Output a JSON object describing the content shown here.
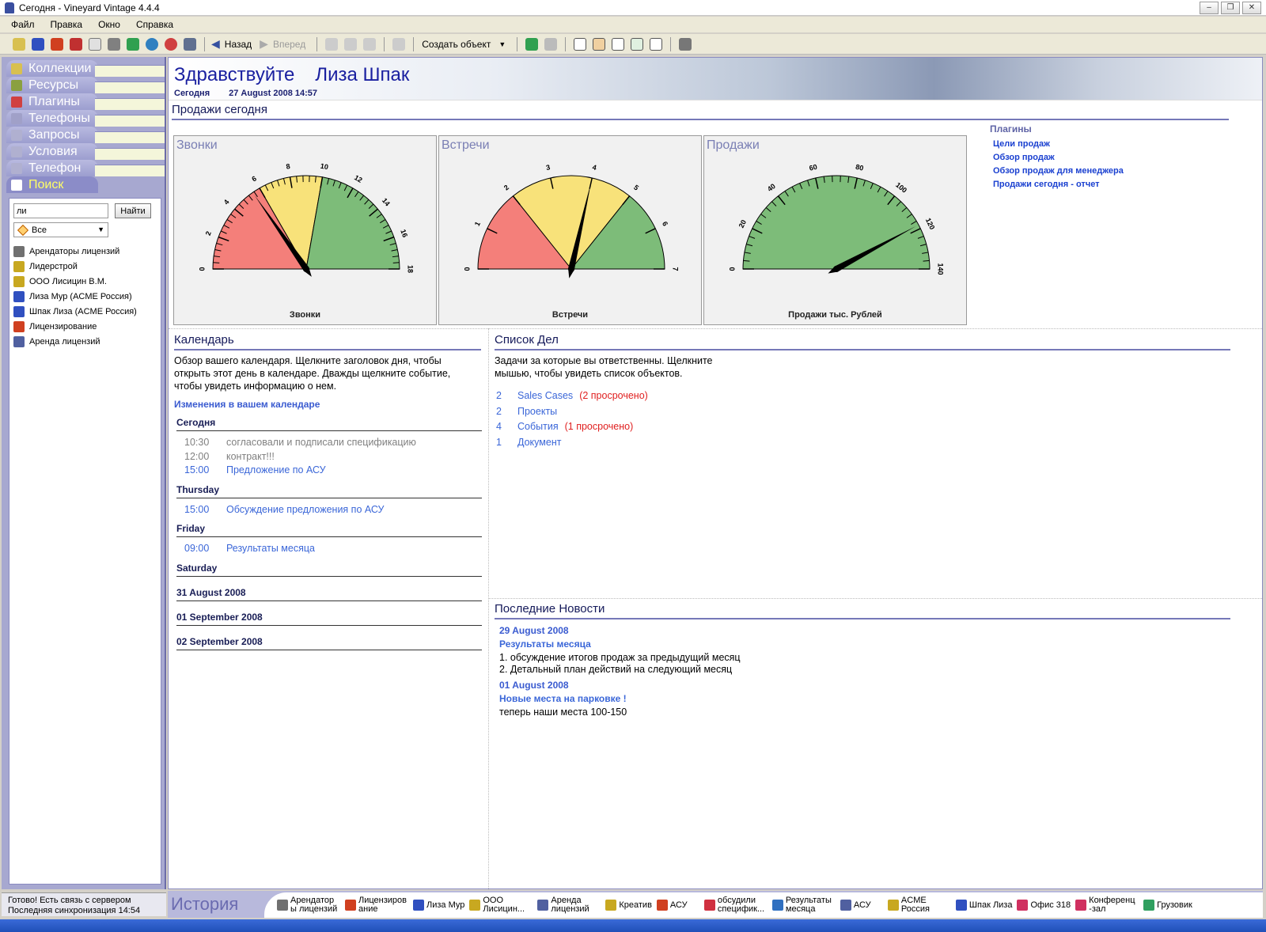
{
  "window": {
    "title": "Сегодня - Vineyard Vintage 4.4.4"
  },
  "menu": [
    "Файл",
    "Правка",
    "Окно",
    "Справка"
  ],
  "toolbar": {
    "back": "Назад",
    "forward": "Вперед",
    "create": "Создать объект"
  },
  "nav": {
    "tabs": [
      {
        "label": "Коллекции",
        "icon": "collections-icon",
        "color": "#d8c050"
      },
      {
        "label": "Ресурсы",
        "icon": "resources-icon",
        "color": "#8aa040"
      },
      {
        "label": "Плагины",
        "icon": "plugins-icon",
        "color": "#d04040"
      },
      {
        "label": "Телефоны",
        "icon": "phonebook-icon",
        "color": "#a0a0c8"
      },
      {
        "label": "Запросы",
        "icon": "queries-icon",
        "color": "#b0b0d0"
      },
      {
        "label": "Условия",
        "icon": "conditions-icon",
        "color": "#b0b0d0"
      },
      {
        "label": "Телефон",
        "icon": "phone-icon",
        "color": "#b0b0d0"
      },
      {
        "label": "Поиск",
        "icon": "search-icon",
        "color": "#ffffff"
      }
    ],
    "search_value": "ли",
    "search_button": "Найти",
    "filter_value": "Все",
    "results": [
      {
        "label": "Арендаторы лицензий",
        "icon": "group-icon",
        "color": "#707070"
      },
      {
        "label": "Лидерстрой",
        "icon": "company-icon",
        "color": "#c8a820"
      },
      {
        "label": "ООО Лисицин В.М.",
        "icon": "company-icon",
        "color": "#c8a820"
      },
      {
        "label": "Лиза Мур (ACME Россия)",
        "icon": "person-icon",
        "color": "#3050c0"
      },
      {
        "label": "Шпак Лиза (ACME Россия)",
        "icon": "person-icon",
        "color": "#3050c0"
      },
      {
        "label": "Лицензирование",
        "icon": "project-icon",
        "color": "#d04020"
      },
      {
        "label": "Аренда лицензий",
        "icon": "document-icon",
        "color": "#5060a0"
      }
    ],
    "status_line1": "Готово! Есть связь с сервером",
    "status_line2": "Последняя синхронизация 14:54"
  },
  "banner": {
    "greeting": "Здравствуйте",
    "name": "Лиза Шпак",
    "today": "Сегодня",
    "datetime": "27 August 2008 14:57"
  },
  "sales": {
    "title": "Продажи сегодня",
    "plugins_header": "Плагины",
    "plugins": [
      "Цели продаж",
      "Обзор продаж",
      "Обзор продаж для менеджера",
      "Продажи сегодня - отчет"
    ],
    "gauges": [
      {
        "title": "Звонки",
        "caption": "Звонки",
        "min": 0,
        "max": 18,
        "ticks": [
          0,
          2,
          4,
          6,
          8,
          10,
          12,
          14,
          16,
          18
        ],
        "minor": 4,
        "zones": [
          [
            0,
            6,
            "#f47f7a"
          ],
          [
            6,
            10,
            "#f8e27a"
          ],
          [
            10,
            18,
            "#7dbc79"
          ]
        ],
        "value": 5.5
      },
      {
        "title": "Встречи",
        "caption": "Встречи",
        "min": 0,
        "max": 7,
        "ticks": [
          0,
          1,
          2,
          3,
          4,
          5,
          6,
          7
        ],
        "minor": 0,
        "zones": [
          [
            0,
            2,
            "#f47f7a"
          ],
          [
            2,
            5,
            "#f8e27a"
          ],
          [
            5,
            7,
            "#7dbc79"
          ]
        ],
        "value": 4
      },
      {
        "title": "Продажи",
        "caption": "Продажи тыс. Рублей",
        "min": 0,
        "max": 140,
        "ticks": [
          0,
          20,
          40,
          60,
          80,
          100,
          120,
          140
        ],
        "minor": 4,
        "zones": [
          [
            0,
            140,
            "#7dbc79"
          ]
        ],
        "value": 118
      }
    ]
  },
  "calendar": {
    "title": "Календарь",
    "desc": "Обзор вашего календаря. Щелкните заголовок дня, чтобы открыть этот день в календаре. Дважды щелкните событие, чтобы увидеть информацию о нем.",
    "changes": "Изменения в вашем календаре",
    "days": [
      {
        "label": "Сегодня",
        "events": [
          {
            "time": "10:30",
            "text": "согласовали и подписали спецификацию",
            "style": "gray"
          },
          {
            "time": "12:00",
            "text": "контракт!!!",
            "style": "gray"
          },
          {
            "time": "15:00",
            "text": "Предложение по АСУ",
            "style": "blue"
          }
        ]
      },
      {
        "label": "Thursday",
        "events": [
          {
            "time": "15:00",
            "text": "Обсуждение предложения по АСУ",
            "style": "blue"
          }
        ]
      },
      {
        "label": "Friday",
        "events": [
          {
            "time": "09:00",
            "text": "Результаты месяца",
            "style": "blue"
          }
        ]
      },
      {
        "label": "Saturday",
        "events": []
      },
      {
        "label": "31 August 2008",
        "events": []
      },
      {
        "label": "01 September 2008",
        "events": []
      },
      {
        "label": "02 September 2008",
        "events": []
      }
    ]
  },
  "todo": {
    "title": "Список Дел",
    "desc": "Задачи за которые вы ответственны. Щелкните мышью, чтобы увидеть список объектов.",
    "items": [
      {
        "count": "2",
        "label": "Sales Cases",
        "overdue": "(2 просрочено)"
      },
      {
        "count": "2",
        "label": "Проекты",
        "overdue": ""
      },
      {
        "count": "4",
        "label": "События",
        "overdue": "(1 просрочено)"
      },
      {
        "count": "1",
        "label": "Документ",
        "overdue": ""
      }
    ]
  },
  "news": {
    "title": "Последние Новости",
    "items": [
      {
        "date": "29 August 2008",
        "headline": "Результаты месяца",
        "lines": [
          "1. обсуждение итогов продаж за предыдущий месяц",
          "2. Детальный план действий на следующий месяц"
        ]
      },
      {
        "date": "01 August 2008",
        "headline": "Новые места на парковке !",
        "lines": [
          "теперь наши места 100-150"
        ]
      }
    ]
  },
  "history": {
    "label": "История",
    "items": [
      {
        "label": "Арендатор ы лицензий",
        "color": "#707070"
      },
      {
        "label": "Лицензиров ание",
        "color": "#d04020"
      },
      {
        "label": "Лиза Мур",
        "color": "#3050c0"
      },
      {
        "label": "ООО Лисицин...",
        "color": "#c8a820"
      },
      {
        "label": "Аренда лицензий",
        "color": "#5060a0"
      },
      {
        "label": "Креатив",
        "color": "#c8a820"
      },
      {
        "label": "АСУ",
        "color": "#d04020"
      },
      {
        "label": "обсудили специфик...",
        "color": "#d03040"
      },
      {
        "label": "Результаты месяца",
        "color": "#3070c0"
      },
      {
        "label": "АСУ",
        "color": "#5060a0"
      },
      {
        "label": "ACME Россия",
        "color": "#c8a820"
      },
      {
        "label": "Шпак Лиза",
        "color": "#3050c0"
      },
      {
        "label": "Офис 318",
        "color": "#d03060"
      },
      {
        "label": "Конференц -зал",
        "color": "#d03060"
      },
      {
        "label": "Грузовик",
        "color": "#30a060"
      }
    ]
  }
}
